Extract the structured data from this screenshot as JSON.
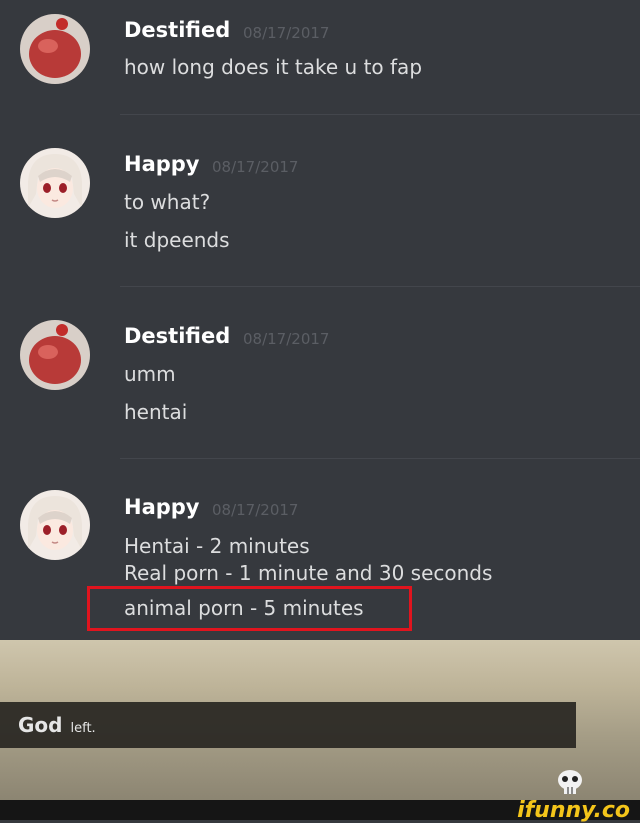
{
  "messages": [
    {
      "author": "Destified",
      "timestamp": "08/17/2017",
      "avatar": "red-blob-avatar",
      "lines": [
        "how long does it take u to fap"
      ]
    },
    {
      "author": "Happy",
      "timestamp": "08/17/2017",
      "avatar": "anime-girl-avatar",
      "lines": [
        "to what?",
        "it dpeends"
      ]
    },
    {
      "author": "Destified",
      "timestamp": "08/17/2017",
      "avatar": "red-blob-avatar",
      "lines": [
        "umm",
        "hentai"
      ]
    },
    {
      "author": "Happy",
      "timestamp": "08/17/2017",
      "avatar": "anime-girl-avatar",
      "lines": [
        "Hentai - 2 minutes",
        "Real porn - 1 minute and 30 seconds",
        "animal porn - 5 minutes"
      ]
    }
  ],
  "highlight_color": "#e0141e",
  "game": {
    "notice_name": "God",
    "notice_action": "left."
  },
  "watermark": "ifunny.co",
  "colors": {
    "background": "#36393e",
    "author": "#ffffff",
    "message": "#dcddde",
    "timestamp": "#5b5e64",
    "watermark": "#f4c51a"
  }
}
